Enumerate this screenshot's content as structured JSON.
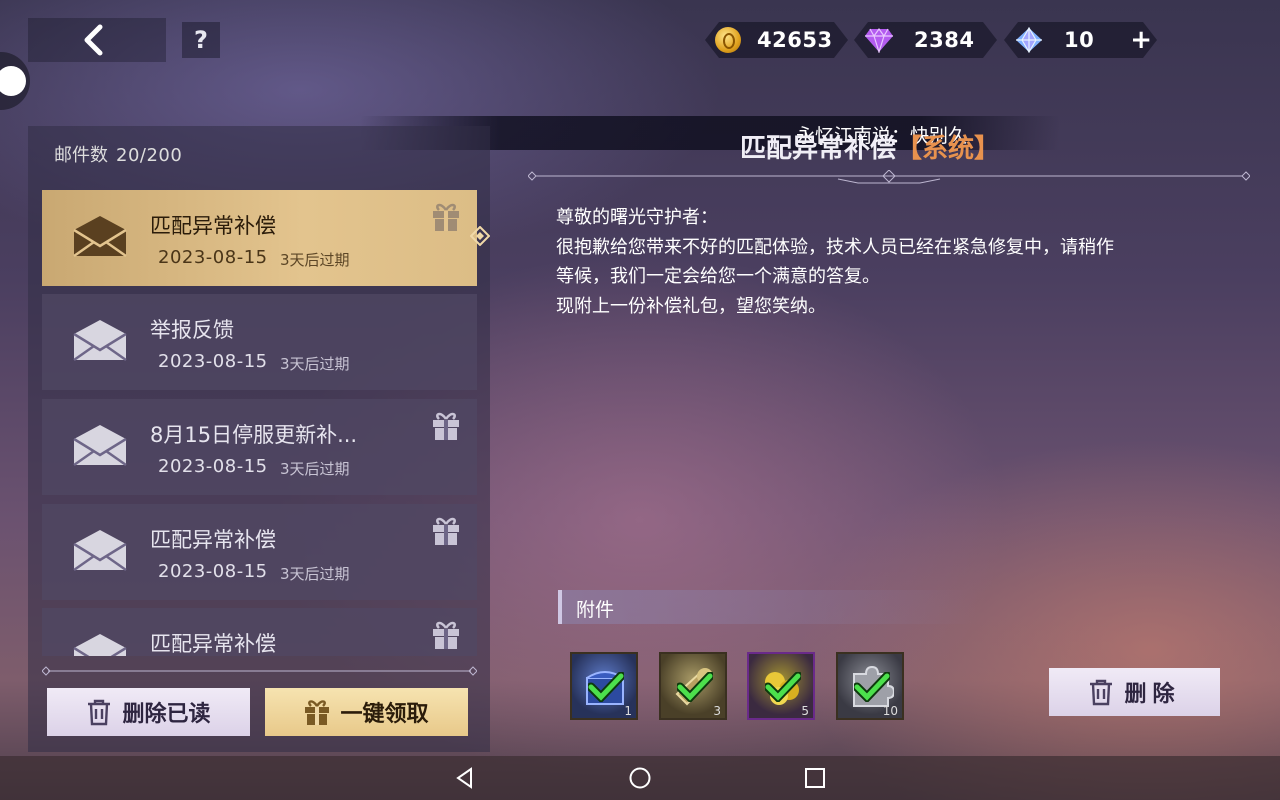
{
  "header": {
    "back_icon": "chevron-left-icon",
    "help_label": "?",
    "currencies": [
      {
        "icon": "gold-coin-icon",
        "value": "42653"
      },
      {
        "icon": "purple-diamond-icon",
        "value": "2384"
      },
      {
        "icon": "blue-crystal-icon",
        "value": "10",
        "add_label": "+"
      }
    ]
  },
  "ticker": {
    "text": "永忆江南说：快别久"
  },
  "mailbox": {
    "count_label": "邮件数",
    "count_value": "20/200",
    "items": [
      {
        "title": "匹配异常补偿",
        "date": "2023-08-15",
        "expire": "3天后过期",
        "has_gift": true,
        "selected": true
      },
      {
        "title": "举报反馈",
        "date": "2023-08-15",
        "expire": "3天后过期",
        "has_gift": false,
        "selected": false
      },
      {
        "title": "8月15日停服更新补...",
        "date": "2023-08-15",
        "expire": "3天后过期",
        "has_gift": true,
        "selected": false
      },
      {
        "title": "匹配异常补偿",
        "date": "2023-08-15",
        "expire": "3天后过期",
        "has_gift": true,
        "selected": false
      },
      {
        "title": "匹配异常补偿",
        "date": "",
        "expire": "",
        "has_gift": true,
        "selected": false
      }
    ],
    "delete_read_label": "删除已读",
    "claim_all_label": "一键领取"
  },
  "detail": {
    "title": "匹配异常补偿",
    "tag": "【系统】",
    "greeting": "尊敬的曙光守护者：",
    "line1": "很抱歉给您带来不好的匹配体验，技术人员已经在紧急修复中，请稍作",
    "line2": "等候，我们一定会给您一个满意的答复。",
    "line3": "现附上一份补偿礼包，望您笑纳。",
    "attachments_label": "附件",
    "attachments": [
      {
        "icon": "blue-chest-icon",
        "qty": "1",
        "claimed": true
      },
      {
        "icon": "horn-icon",
        "qty": "3",
        "claimed": true
      },
      {
        "icon": "gold-coins-pile-icon",
        "qty": "5",
        "claimed": true
      },
      {
        "icon": "puzzle-piece-icon",
        "qty": "10",
        "claimed": true
      }
    ],
    "delete_label": "删除"
  },
  "colors": {
    "selected_mail": "#e3c48e",
    "tag": "#e8924e",
    "check": "#4ce04c"
  }
}
